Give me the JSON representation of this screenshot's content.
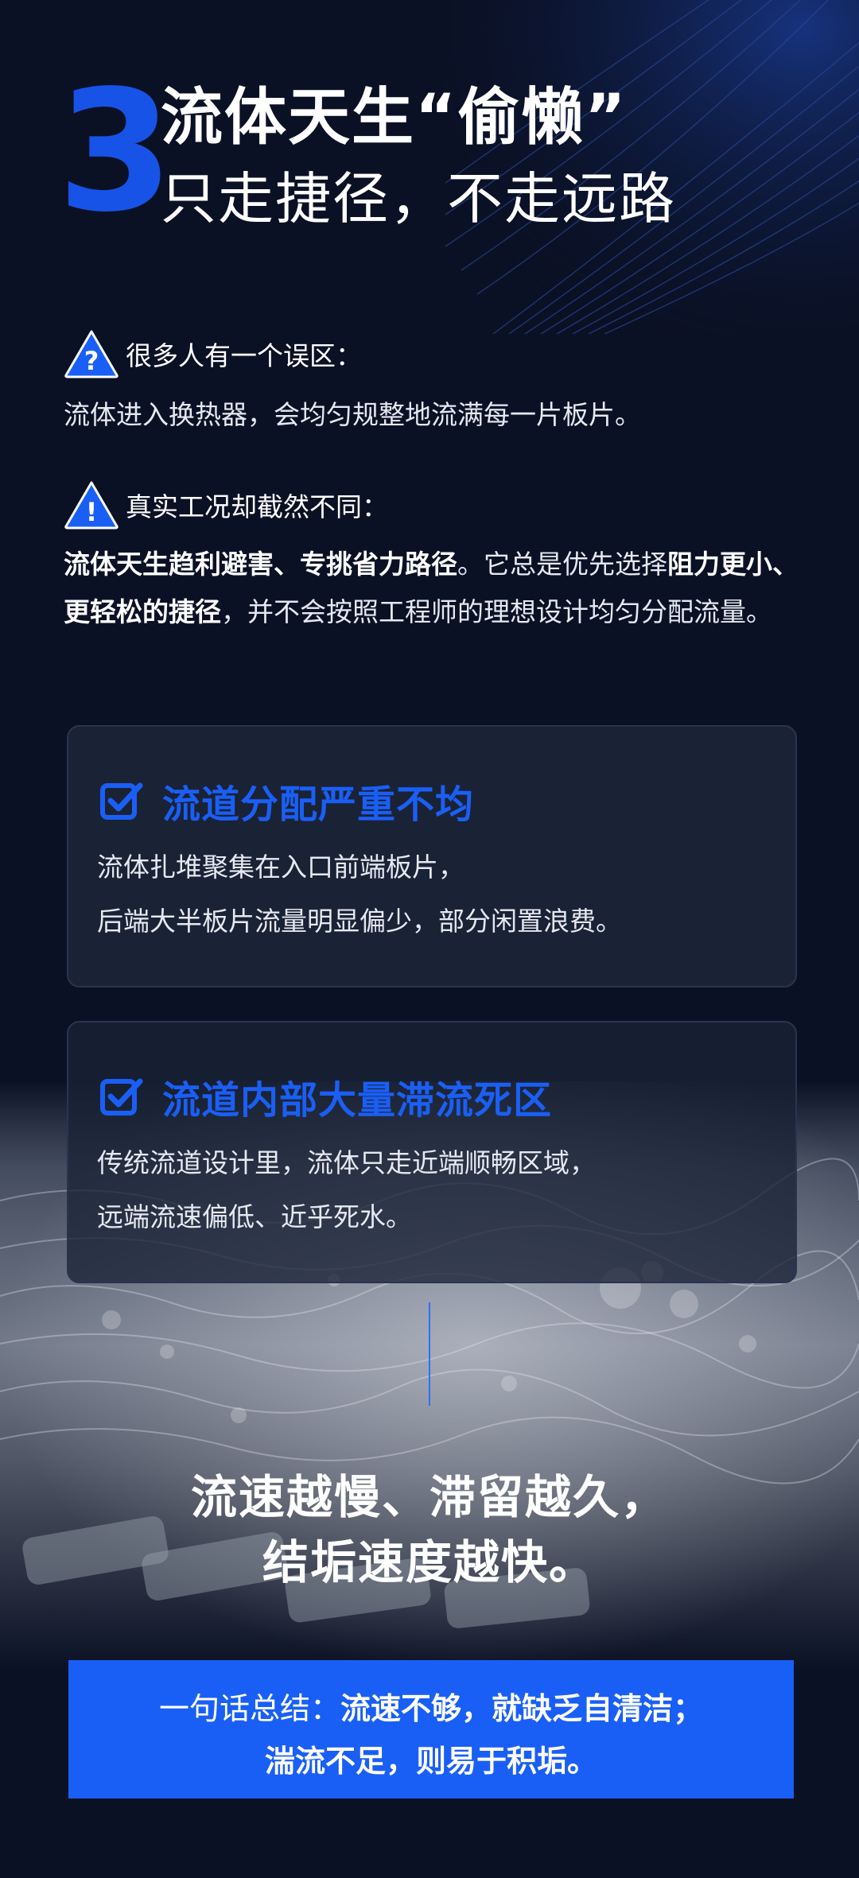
{
  "heading": {
    "number": "3",
    "title_line1": "流体天生“偷懒”",
    "title_line2": "只走捷径，不走远路"
  },
  "misconception": {
    "icon": "question-warning-icon",
    "label": "很多人有一个误区：",
    "text": "流体进入换热器，会均匀规整地流满每一片板片。"
  },
  "reality": {
    "icon": "exclamation-warning-icon",
    "label": "真实工况却截然不同：",
    "bold1": "流体天生趋利避害、专挑省力路径",
    "text1": "。它总是优先选择",
    "bold2": "阻力更小、更轻松的捷径",
    "text2": "，并不会按照工程师的理想设计均匀分配流量。"
  },
  "cards": [
    {
      "icon": "checkbox-icon",
      "title": "流道分配严重不均",
      "lines": [
        "流体扎堆聚集在入口前端板片，",
        "后端大半板片流量明显偏少，部分闲置浪费。"
      ]
    },
    {
      "icon": "checkbox-icon",
      "title": "流道内部大量滞流死区",
      "lines": [
        "传统流道设计里，流体只走近端顺畅区域，",
        "远端流速偏低、近乎死水。"
      ]
    }
  ],
  "conclusion": {
    "line1": "流速越慢、滞留越久，",
    "line2": "结垢速度越快。"
  },
  "summary": {
    "prefix": "一句话总结：",
    "bold1": "流速不够，就缺乏自清洁；",
    "bold2": "湍流不足，则易于积垢。"
  },
  "colors": {
    "background": "#0b1125",
    "accent_blue": "#1a5ff5",
    "card": "#1a2236"
  }
}
